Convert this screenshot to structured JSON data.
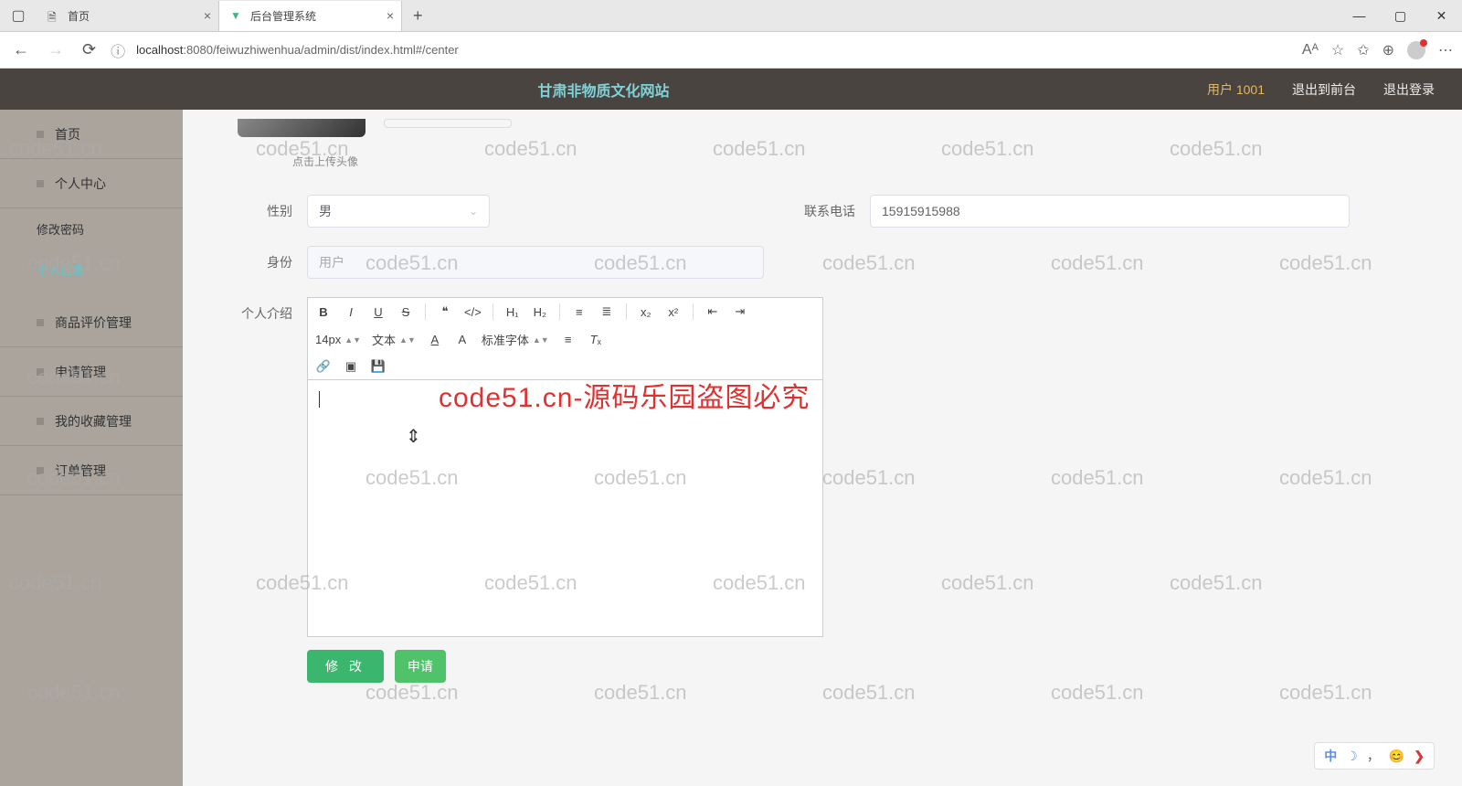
{
  "browser": {
    "tab1": "首页",
    "tab2": "后台管理系统",
    "url_host": "localhost",
    "url_rest": ":8080/feiwuzhiwenhua/admin/dist/index.html#/center"
  },
  "header": {
    "title": "甘肃非物质文化网站",
    "user": "用户 1001",
    "link_front": "退出到前台",
    "link_logout": "退出登录"
  },
  "sidebar": {
    "items": [
      {
        "label": "首页"
      },
      {
        "label": "个人中心"
      },
      {
        "label": "修改密码"
      },
      {
        "label": "个人信息"
      },
      {
        "label": "商品评价管理"
      },
      {
        "label": "申请管理"
      },
      {
        "label": "我的收藏管理"
      },
      {
        "label": "订单管理"
      }
    ]
  },
  "form": {
    "avatar_hint": "点击上传头像",
    "gender_label": "性别",
    "gender_value": "男",
    "phone_label": "联系电话",
    "phone_value": "15915915988",
    "identity_label": "身份",
    "identity_value": "用户",
    "bio_label": "个人介绍"
  },
  "toolbar": {
    "size": "14px",
    "text": "文本",
    "font": "标准字体"
  },
  "buttons": {
    "modify": "修 改",
    "apply": "申请"
  },
  "watermark": "code51.cn",
  "watermark_red": "code51.cn-源码乐园盗图必究",
  "ime": {
    "cn": "中",
    "moon": "☽",
    "comma": "，",
    "sym": "❯"
  }
}
